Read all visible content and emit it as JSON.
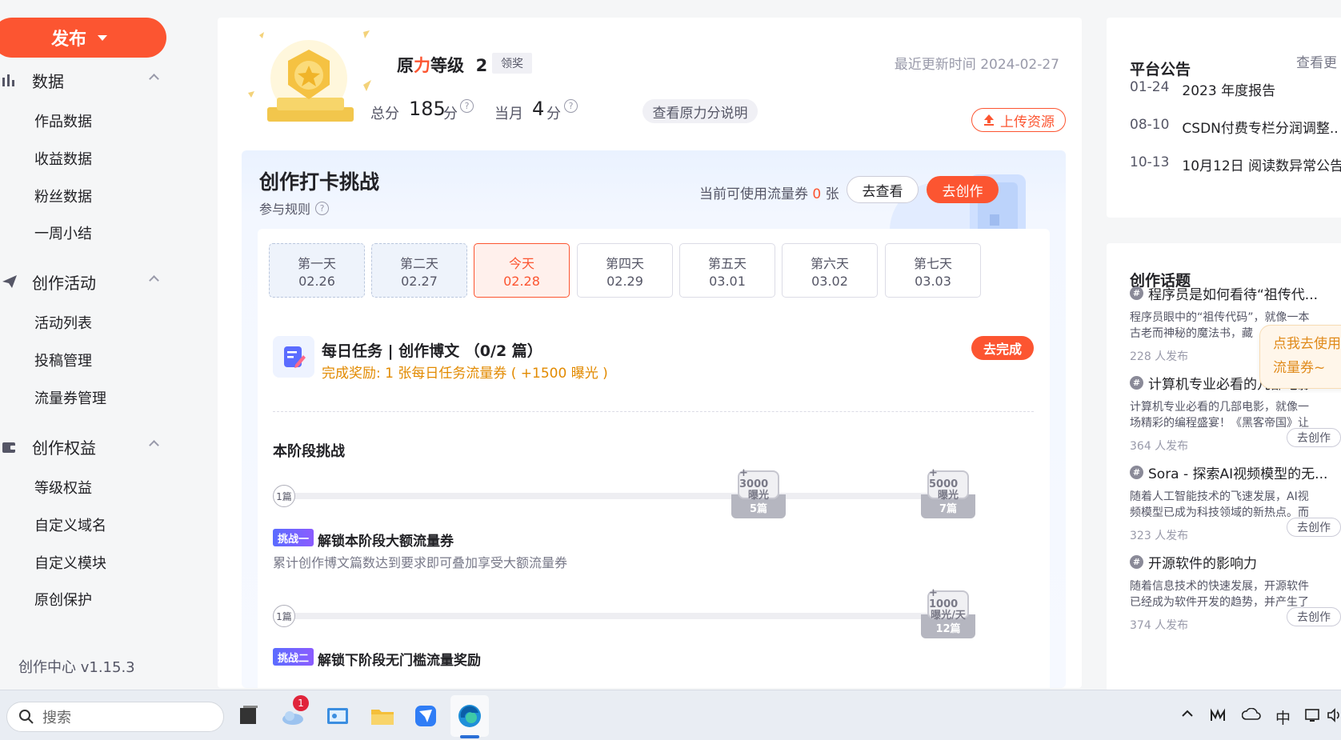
{
  "sidebar": {
    "publish_label": "发布",
    "groups": [
      {
        "label": "数据",
        "icon": "bar-chart-icon",
        "items": [
          "作品数据",
          "收益数据",
          "粉丝数据",
          "一周小结"
        ]
      },
      {
        "label": "创作活动",
        "icon": "paper-plane-icon",
        "items": [
          "活动列表",
          "投稿管理",
          "流量券管理"
        ]
      },
      {
        "label": "创作权益",
        "icon": "wallet-icon",
        "items": [
          "等级权益",
          "自定义域名",
          "自定义模块",
          "原创保护"
        ]
      }
    ],
    "version": "创作中心 v1.15.3"
  },
  "header": {
    "level_prefix": "原",
    "level_red": "力",
    "level_suffix": "等级",
    "level_value": "2",
    "claim_label": "领奖",
    "updated": "最近更新时间 2024-02-27",
    "total_label": "总分",
    "total_value": "185",
    "total_unit": "分",
    "month_label": "当月",
    "month_value": "4",
    "month_unit": "分",
    "explain_label": "查看原力分说明",
    "upload_label": "上传资源"
  },
  "challenge": {
    "title": "创作打卡挑战",
    "rules_label": "参与规则",
    "coupon_prefix": "当前可使用流量券",
    "coupon_count": "0",
    "coupon_suffix": "张",
    "view_label": "去查看",
    "create_label": "去创作",
    "days": [
      {
        "name": "第一天",
        "date": "02.26",
        "state": "past"
      },
      {
        "name": "第二天",
        "date": "02.27",
        "state": "past"
      },
      {
        "name": "今天",
        "date": "02.28",
        "state": "today"
      },
      {
        "name": "第四天",
        "date": "02.29",
        "state": "future"
      },
      {
        "name": "第五天",
        "date": "03.01",
        "state": "future"
      },
      {
        "name": "第六天",
        "date": "03.02",
        "state": "future"
      },
      {
        "name": "第七天",
        "date": "03.03",
        "state": "future"
      }
    ],
    "task": {
      "title": "每日任务 | 创作博文 （0/2 篇）",
      "reward": "完成奖励: 1 张每日任务流量券 ( +1500 曝光 )",
      "button": "去完成"
    },
    "stage_title": "本阶段挑战",
    "track1": {
      "start": "1篇",
      "milestones": [
        {
          "top1": "+ 3000",
          "top2": "曝光",
          "label": "5篇"
        },
        {
          "top1": "+ 5000",
          "top2": "曝光",
          "label": "7篇"
        }
      ]
    },
    "challenge1": {
      "badge": "挑战一",
      "name": "解锁本阶段大额流量券",
      "desc": "累计创作博文篇数达到要求即可叠加享受大额流量券"
    },
    "track2": {
      "start": "1篇",
      "milestones": [
        {
          "top1": "+ 1000",
          "top2": "曝光/天",
          "label": "12篇"
        }
      ]
    },
    "challenge2": {
      "badge": "挑战二",
      "name": "解锁下阶段无门槛流量奖励"
    }
  },
  "notice": {
    "title": "平台公告",
    "more": "查看更",
    "items": [
      {
        "date": "01-24",
        "text": "2023 年度报告"
      },
      {
        "date": "08-10",
        "text": "CSDN付费专栏分润调整.."
      },
      {
        "date": "10-13",
        "text": "10月12日 阅读数异常公告"
      }
    ]
  },
  "topics": {
    "title": "创作话题",
    "items": [
      {
        "name": "程序员是如何看待“祖传代...",
        "desc": "程序员眼中的“祖传代码”，就像一本古老而神秘的魔法书，藏",
        "count": "228 人发布",
        "action": ""
      },
      {
        "name": "计算机专业必看的几部电影",
        "desc": "计算机专业必看的几部电影，就像一场精彩的编程盛宴！《黑客帝国》让你穿...",
        "count": "364 人发布",
        "action": "去创作"
      },
      {
        "name": "Sora - 探索AI视频模型的无...",
        "desc": "随着人工智能技术的飞速发展，AI视频模型已成为科技领域的新热点。而在这...",
        "count": "323 人发布",
        "action": "去创作"
      },
      {
        "name": "开源软件的影响力",
        "desc": "随着信息技术的快速发展，开源软件已经成为软件开发的趋势，并产生了深远...",
        "count": "374 人发布",
        "action": "去创作"
      }
    ],
    "float_tip": "点我去使用流量券~"
  },
  "taskbar": {
    "search_placeholder": "搜索",
    "badge_count": "1",
    "ime_label": "中"
  },
  "colors": {
    "accent": "#fc5531",
    "reward": "#e28a00",
    "badge_from": "#5b6cff",
    "badge_to": "#8b5cff"
  }
}
